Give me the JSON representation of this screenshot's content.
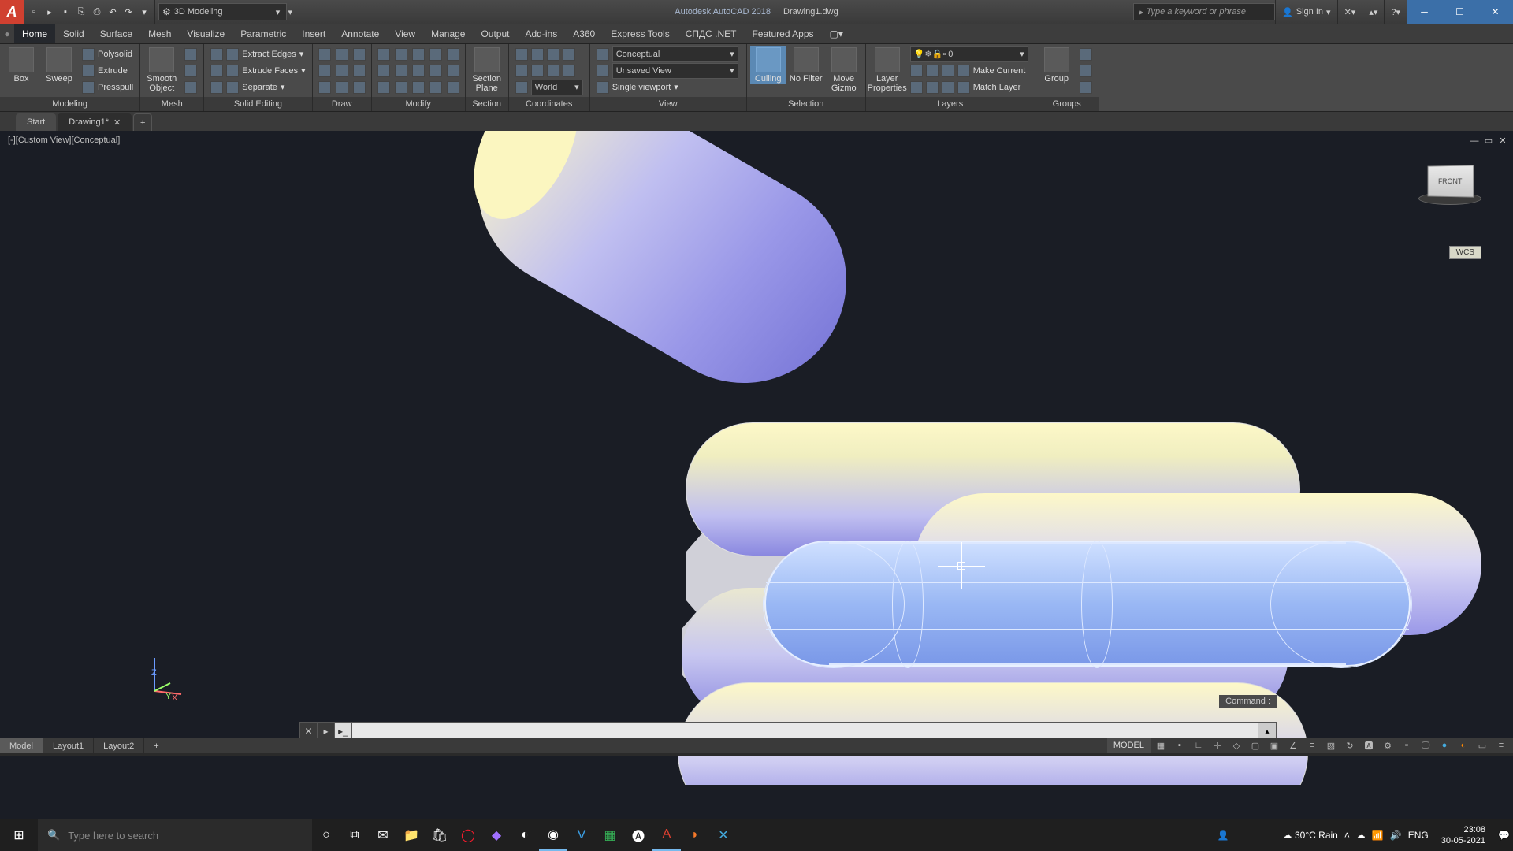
{
  "title": {
    "app": "Autodesk AutoCAD 2018",
    "doc": "Drawing1.dwg"
  },
  "workspace": "3D Modeling",
  "search_placeholder": "Type a keyword or phrase",
  "signin": "Sign In",
  "menu": [
    "Home",
    "Solid",
    "Surface",
    "Mesh",
    "Visualize",
    "Parametric",
    "Insert",
    "Annotate",
    "View",
    "Manage",
    "Output",
    "Add-ins",
    "A360",
    "Express Tools",
    "СПДС .NET",
    "Featured Apps"
  ],
  "ribbon": {
    "modeling": {
      "label": "Modeling",
      "box": "Box",
      "sweep": "Sweep",
      "polysolid": "Polysolid",
      "extrude": "Extrude",
      "presspull": "Presspull",
      "smooth": "Smooth Object"
    },
    "mesh": {
      "label": "Mesh"
    },
    "solid_editing": {
      "label": "Solid Editing",
      "extract_edges": "Extract Edges",
      "extrude_faces": "Extrude Faces",
      "separate": "Separate"
    },
    "draw": {
      "label": "Draw"
    },
    "modify": {
      "label": "Modify"
    },
    "section": {
      "label": "Section",
      "section_plane": "Section Plane"
    },
    "coordinates": {
      "label": "Coordinates",
      "world": "World"
    },
    "view": {
      "label": "View",
      "style": "Conceptual",
      "saved": "Unsaved View",
      "viewport": "Single viewport"
    },
    "selection": {
      "label": "Selection",
      "culling": "Culling",
      "nofilter": "No Filter",
      "gizmo": "Move Gizmo"
    },
    "layers": {
      "label": "Layers",
      "props": "Layer Properties",
      "layer0": "0",
      "make_current": "Make Current",
      "match": "Match Layer"
    },
    "groups": {
      "label": "Groups",
      "group": "Group"
    }
  },
  "tabs": {
    "start": "Start",
    "drawing": "Drawing1*"
  },
  "viewport": {
    "label": "[-][Custom View][Conceptual]",
    "cube": "FRONT",
    "wcs": "WCS"
  },
  "cmd": {
    "hint": "Command :",
    "input": ""
  },
  "bottom_tabs": [
    "Model",
    "Layout1",
    "Layout2"
  ],
  "status_model": "MODEL",
  "taskbar": {
    "search": "Type here to search",
    "weather": "30°C Rain",
    "lang": "ENG",
    "time": "23:08",
    "date": "30-05-2021"
  }
}
